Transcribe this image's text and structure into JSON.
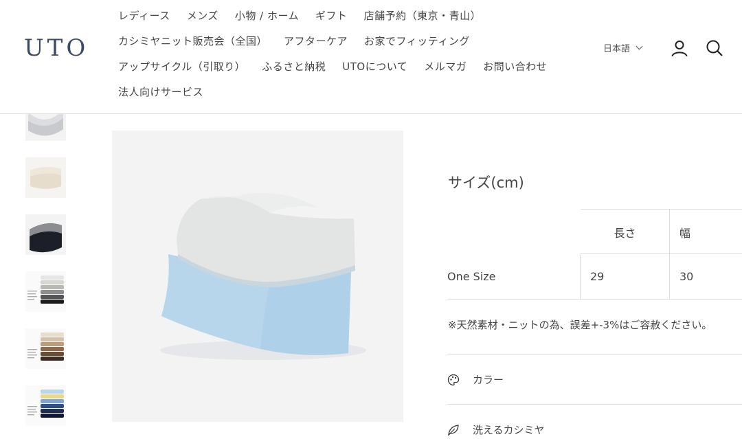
{
  "brand": {
    "logo": "UTO",
    "logo_color": "#3d4a66"
  },
  "nav": {
    "rows": [
      [
        "レディース",
        "メンズ",
        "小物 / ホーム",
        "ギフト",
        "店舗予約（東京・青山）"
      ],
      [
        "カシミヤニット販売会（全国）",
        "アフターケア",
        "お家でフィッティング"
      ],
      [
        "アップサイクル（引取り）",
        "ふるさと納税",
        "UTOについて",
        "メルマガ",
        "お問い合わせ"
      ],
      [
        "法人向けサービス"
      ]
    ]
  },
  "header_tools": {
    "language": "日本語",
    "icons": [
      "chevron-down-icon",
      "account-icon",
      "search-icon"
    ]
  },
  "gallery": {
    "thumbnails": [
      "light-gray-snood",
      "beige-snood",
      "black-gray-snood",
      "stacked-light-colors",
      "stacked-brown-colors",
      "stacked-blue-yellow-colors"
    ]
  },
  "size_chart": {
    "title": "サイズ(cm)",
    "headers": [
      "長さ",
      "幅"
    ],
    "rows": [
      {
        "label": "One Size",
        "values": [
          "29",
          "30"
        ]
      }
    ],
    "note": "※天然素材・ニットの為、誤差+-3%はご容赦ください。"
  },
  "accordions": [
    {
      "label": "カラー",
      "icon": "palette-icon"
    },
    {
      "label": "洗えるカシミヤ",
      "icon": "leaf-icon"
    }
  ]
}
